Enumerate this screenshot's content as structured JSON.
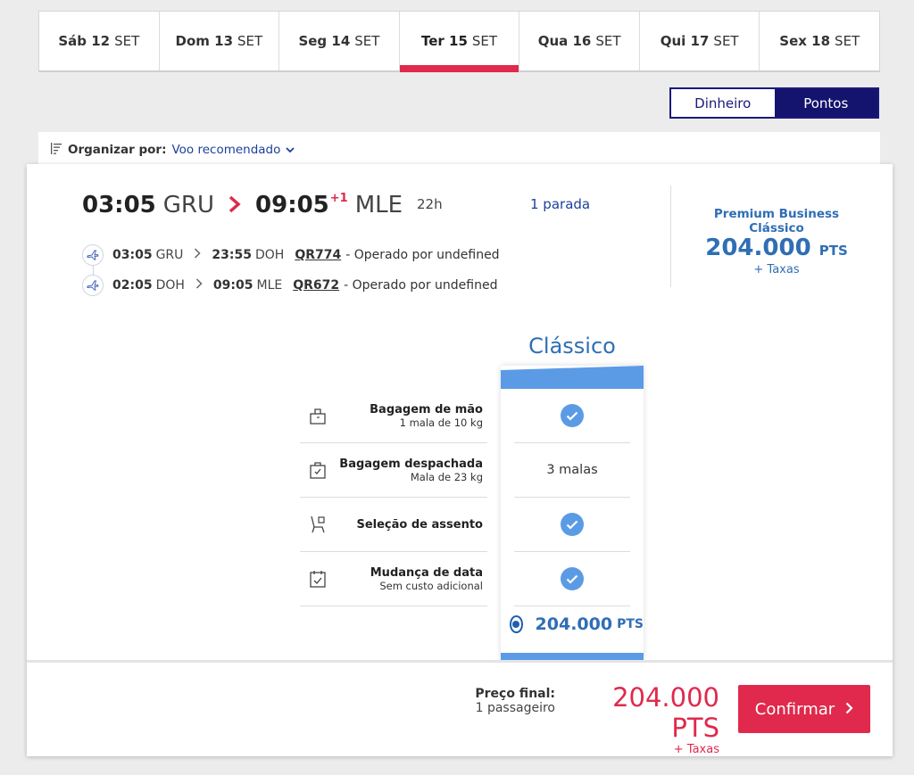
{
  "date_tabs": [
    {
      "dow": "Sáb 12",
      "month": "SET"
    },
    {
      "dow": "Dom 13",
      "month": "SET"
    },
    {
      "dow": "Seg 14",
      "month": "SET"
    },
    {
      "dow": "Ter 15",
      "month": "SET"
    },
    {
      "dow": "Qua 16",
      "month": "SET"
    },
    {
      "dow": "Qui 17",
      "month": "SET"
    },
    {
      "dow": "Sex 18",
      "month": "SET"
    }
  ],
  "currency": {
    "cash": "Dinheiro",
    "points": "Pontos",
    "selected": "Pontos"
  },
  "sort": {
    "label": "Organizar por:",
    "value": "Voo recomendado"
  },
  "flight": {
    "dep_time": "03:05",
    "dep_airport": "GRU",
    "arr_time": "09:05",
    "arr_day_offset": "+1",
    "arr_airport": "MLE",
    "duration": "22h",
    "stops": "1 parada",
    "segments": [
      {
        "dep_time": "03:05",
        "dep_airport": "GRU",
        "arr_time": "23:55",
        "arr_airport": "DOH",
        "flight_no": "QR774",
        "operator": "- Operado por undefined"
      },
      {
        "dep_time": "02:05",
        "dep_airport": "DOH",
        "arr_time": "09:05",
        "arr_airport": "MLE",
        "flight_no": "QR672",
        "operator": "- Operado por undefined"
      }
    ]
  },
  "fare": {
    "name": "Premium Business Clássico",
    "price": "204.000",
    "unit": "PTS",
    "taxes": "+ Taxas"
  },
  "benefits": {
    "column_title": "Clássico",
    "rows": [
      {
        "title": "Bagagem de mão",
        "subtitle": "1 mala de 10 kg",
        "icon": "carry-on-bag-icon",
        "value": "check"
      },
      {
        "title": "Bagagem despachada",
        "subtitle": "Mala de 23 kg",
        "icon": "checked-bag-icon",
        "value": "3 malas"
      },
      {
        "title": "Seleção de assento",
        "subtitle": "",
        "icon": "seat-icon",
        "value": "check"
      },
      {
        "title": "Mudança de data",
        "subtitle": "Sem custo adicional",
        "icon": "calendar-icon",
        "value": "check"
      }
    ],
    "price": "204.000",
    "unit": "PTS"
  },
  "footer": {
    "final_label": "Preço final:",
    "passengers": "1 passageiro",
    "total": "204.000 PTS",
    "taxes": "+ Taxas",
    "confirm": "Confirmar"
  },
  "colors": {
    "accent_red": "#e0294c",
    "navy": "#14146e",
    "blue": "#2f6eb5",
    "light_blue": "#5b9be6"
  }
}
